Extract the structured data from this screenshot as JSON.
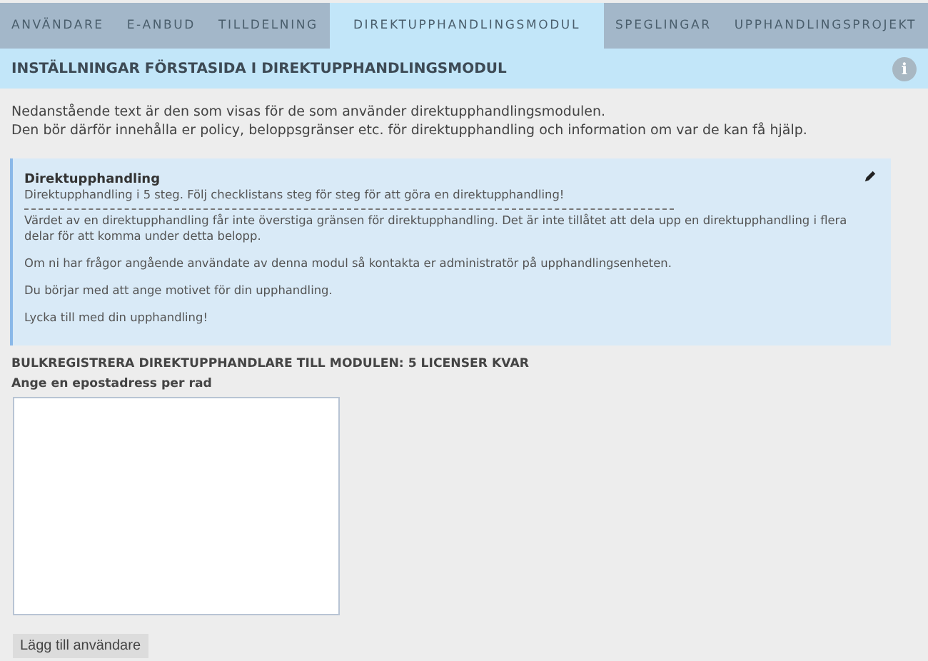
{
  "tabs": [
    {
      "label": "ANVÄNDARE",
      "selected": false
    },
    {
      "label": "E-ANBUD",
      "selected": false
    },
    {
      "label": "TILLDELNING",
      "selected": false
    },
    {
      "label": "DIREKTUPPHANDLINGSMODUL",
      "selected": true
    },
    {
      "label": "SPEGLINGAR",
      "selected": false
    },
    {
      "label": "UPPHANDLINGSPROJEKT",
      "selected": false
    }
  ],
  "header": {
    "title": "INSTÄLLNINGAR FÖRSTASIDA I DIREKTUPPHANDLINGSMODUL",
    "info_icon": "i"
  },
  "intro": [
    "Nedanstående text är den som visas för de som använder direktupphandlingsmodulen.",
    "Den bör därför innehålla er policy, beloppsgränser etc. för direktupphandling och information om var de kan få hjälp."
  ],
  "notice": {
    "title": "Direktupphandling",
    "subtitle": "Direktupphandling i 5 steg. Följ checklistans steg för steg för att göra en direktupphandling!",
    "paragraphs": [
      "Värdet av en direktupphandling får inte överstiga gränsen för direktupphandling. Det är inte tillåtet att dela upp en direktupphandling i flera delar för att komma under detta belopp.",
      "Om ni har frågor angående användate av denna modul så kontakta er administratör på upphandlingsenheten.",
      "Du börjar med att ange motivet för din upphandling.",
      "Lycka till med din upphandling!"
    ]
  },
  "bulk": {
    "heading": "BULKREGISTRERA DIREKTUPPHANDLARE TILL MODULEN: 5 LICENSER KVAR",
    "label": "Ange en epostadress per rad",
    "button": "Lägg till användare"
  }
}
